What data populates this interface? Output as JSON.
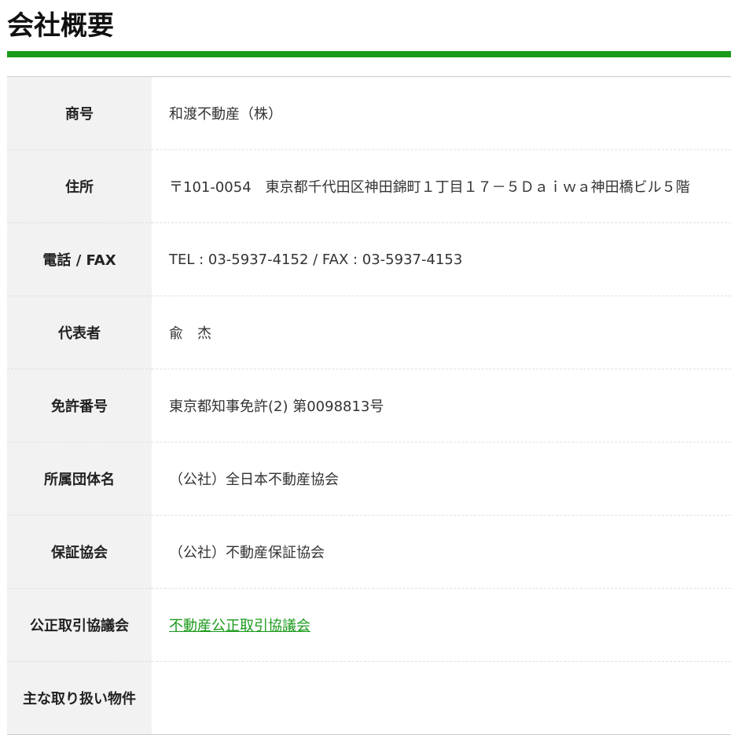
{
  "page": {
    "title": "会社概要"
  },
  "colors": {
    "accent": "#1a9a1a",
    "label_bg": "#f2f2f2"
  },
  "rows": [
    {
      "label": "商号",
      "value": "和渡不動産（株）"
    },
    {
      "label": "住所",
      "value": "〒101-0054　東京都千代田区神田錦町１丁目１７－５Ｄａｉｗａ神田橋ビル５階"
    },
    {
      "label": "電話 / FAX",
      "value": "TEL : 03-5937-4152 / FAX : 03-5937-4153"
    },
    {
      "label": "代表者",
      "value": "兪　杰"
    },
    {
      "label": "免許番号",
      "value": "東京都知事免許(2) 第0098813号"
    },
    {
      "label": "所属団体名",
      "value": "（公社）全日本不動産協会"
    },
    {
      "label": "保証協会",
      "value": "（公社）不動産保証協会"
    },
    {
      "label": "公正取引協議会",
      "value": "不動産公正取引協議会"
    },
    {
      "label": "主な取り扱い物件",
      "value": ""
    }
  ]
}
